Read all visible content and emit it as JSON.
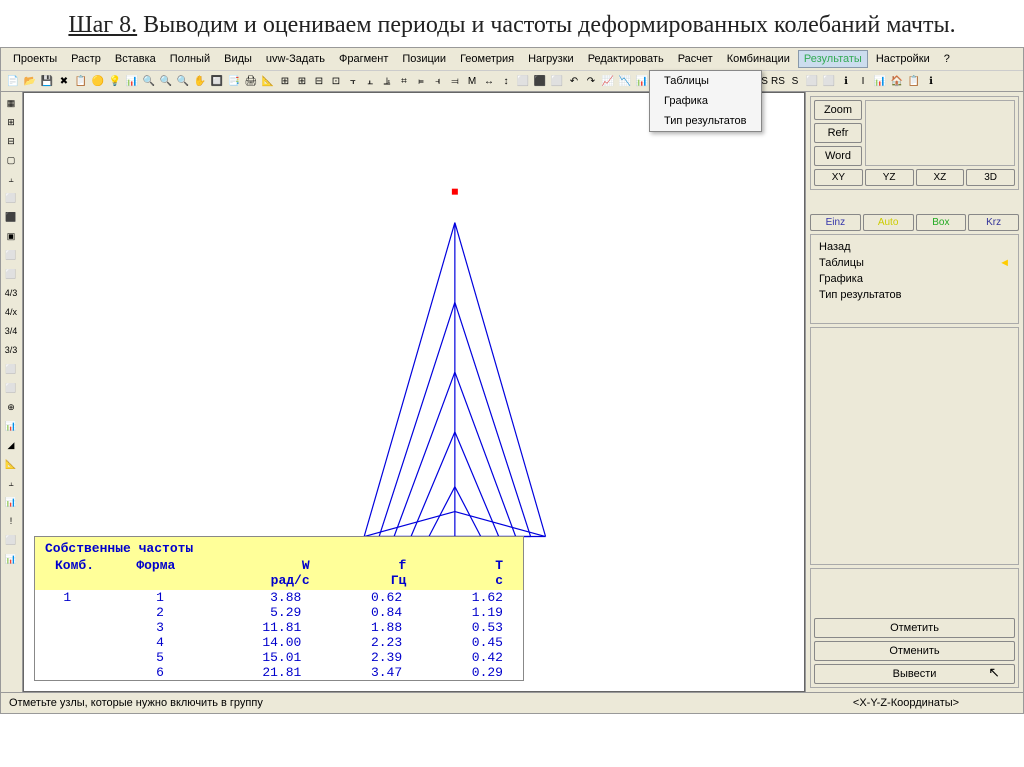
{
  "header": {
    "step": "Шаг 8.",
    "text": " Выводим и оцениваем периоды и частоты деформированных колебаний мачты."
  },
  "menubar": [
    "Проекты",
    "Растр",
    "Вставка",
    "Полный",
    "Виды",
    "uvw-Задать",
    "Фрагмент",
    "Позиции",
    "Геометрия",
    "Нагрузки",
    "Редактировать",
    "Расчет",
    "Комбинации",
    "Результаты",
    "Настройки",
    "?"
  ],
  "menubar_active_index": 13,
  "dropdown": {
    "items": [
      "Таблицы",
      "Графика",
      "Тип результатов"
    ]
  },
  "right": {
    "zoom": "Zoom",
    "refr": "Refr",
    "word": "Word",
    "views": [
      "XY",
      "YZ",
      "XZ",
      "3D"
    ],
    "modes": [
      "Einz",
      "Auto",
      "Box",
      "Krz"
    ],
    "list": [
      "Назад",
      "Таблицы",
      "Графика",
      "Тип результатов"
    ],
    "list_marked_index": 1,
    "mark": "Отметить",
    "cancel": "Отменить",
    "output": "Вывести"
  },
  "chart_data": {
    "type": "table",
    "title": "Собственные частоты",
    "headers1": [
      "Комб.",
      "Форма",
      "W",
      "f",
      "T"
    ],
    "headers2": [
      "",
      "",
      "рад/с",
      "Гц",
      "с"
    ],
    "rows": [
      [
        "1",
        "1",
        "3.88",
        "0.62",
        "1.62"
      ],
      [
        "",
        "2",
        "5.29",
        "0.84",
        "1.19"
      ],
      [
        "",
        "3",
        "11.81",
        "1.88",
        "0.53"
      ],
      [
        "",
        "4",
        "14.00",
        "2.23",
        "0.45"
      ],
      [
        "",
        "5",
        "15.01",
        "2.39",
        "0.42"
      ],
      [
        "",
        "6",
        "21.81",
        "3.47",
        "0.29"
      ]
    ]
  },
  "status": {
    "left": "Отметьте узлы, которые нужно включить в группу",
    "right": "<X-Y-Z-Координаты>"
  },
  "toolbar_icons": [
    "📄",
    "📂",
    "💾",
    "✖",
    "📋",
    "🟡",
    "💡",
    "📊",
    "🔍",
    "🔍",
    "🔍",
    "✋",
    "🔲",
    "📑",
    "🖨",
    "📐",
    "⊞",
    "⊞",
    "⊟",
    "⊡",
    "⫟",
    "⫠",
    "⫡",
    "⌗",
    "⫢",
    "⫣",
    "⫤",
    "M",
    "↔",
    "↕",
    "⬜",
    "⬛",
    "⬜",
    "↶",
    "↷",
    "📈",
    "📉",
    "📊",
    "📋",
    "ℹ",
    "📋",
    "📋",
    "N",
    "M",
    "RS",
    "RS",
    "S",
    "⬜",
    "⬜",
    "ℹ",
    "I",
    "📊",
    "🏠",
    "📋",
    "ℹ"
  ],
  "left_icons": [
    "▦",
    "⊞",
    "⊟",
    "▢",
    "⫠",
    "⬜",
    "⬛",
    "▣",
    "⬜",
    "⬜",
    "4/3",
    "4/x",
    "3/4",
    "3/3",
    "⬜",
    "⬜",
    "⊕",
    "📊",
    "◢",
    "📐",
    "⫠",
    "📊",
    "!",
    "⬜",
    "📊"
  ]
}
